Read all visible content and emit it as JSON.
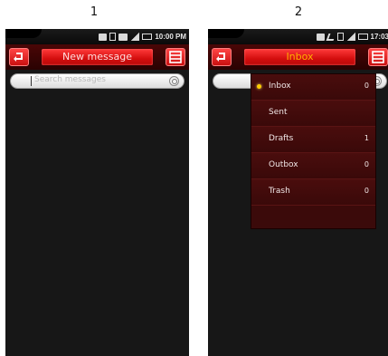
{
  "labels": [
    "1",
    "2"
  ],
  "screen1": {
    "status_time": "10:00 PM",
    "title": "New message",
    "search_placeholder": "Search messages"
  },
  "screen2": {
    "status_time": "17:03",
    "title": "Inbox",
    "dropdown": [
      {
        "label": "Inbox",
        "count": "0",
        "selected": true
      },
      {
        "label": "Sent",
        "count": ""
      },
      {
        "label": "Drafts",
        "count": "1"
      },
      {
        "label": "Outbox",
        "count": "0"
      },
      {
        "label": "Trash",
        "count": "0"
      }
    ]
  },
  "colors": {
    "accent_red": "#e01515",
    "title_text_1": "#ffdede",
    "title_text_2": "#ffb000",
    "bullet": "#ffcc00"
  }
}
